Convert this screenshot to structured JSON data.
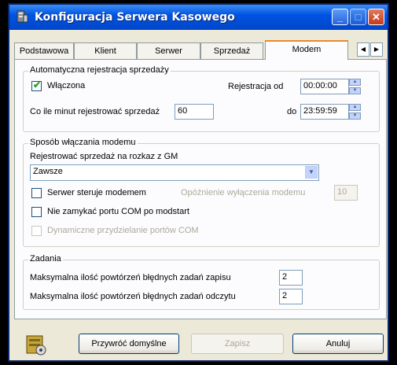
{
  "window": {
    "title": "Konfiguracja Serwera Kasowego",
    "min_glyph": "_",
    "max_glyph": "□",
    "close_glyph": "✕"
  },
  "tabs": [
    {
      "label": "Podstawowa"
    },
    {
      "label": "Klient"
    },
    {
      "label": "Serwer"
    },
    {
      "label": "Sprzedaż"
    },
    {
      "label": "Modem",
      "active": true
    }
  ],
  "tab_scroll": {
    "left": "◀",
    "right": "▶"
  },
  "auto_reg": {
    "legend": "Automatyczna rejestracja sprzedaży",
    "enabled_label": "Włączona",
    "enabled": true,
    "check_glyph": "✔",
    "minutes_label": "Co ile minut rejestrować sprzedaż",
    "minutes_value": "60",
    "from_label": "Rejestracja od",
    "from_value": "00:00:00",
    "to_label": "do",
    "to_value": "23:59:59"
  },
  "modem_mode": {
    "legend": "Sposób włączania modemu",
    "gm_label": "Rejestrować sprzedaż na rozkaz z GM",
    "gm_selected": "Zawsze",
    "server_controls_label": "Serwer steruje modemem",
    "server_controls": false,
    "delay_label": "Opóźnienie wyłączenia modemu",
    "delay_value": "10",
    "no_close_com_label": "Nie zamykać portu COM po modstart",
    "no_close_com": false,
    "dynamic_com_label": "Dynamiczne przydzielanie portów COM",
    "dynamic_com": false
  },
  "tasks": {
    "legend": "Zadania",
    "write_retries_label": "Maksymalna ilość powtórzeń błędnych zadań zapisu",
    "write_retries_value": "2",
    "read_retries_label": "Maksymalna ilość powtórzeń błędnych zadań odczytu",
    "read_retries_value": "2"
  },
  "buttons": {
    "defaults": "Przywróć domyślne",
    "save": "Zapisz",
    "cancel": "Anuluj"
  },
  "icons": {
    "app": "server-app-icon",
    "footer": "gear-icon"
  }
}
